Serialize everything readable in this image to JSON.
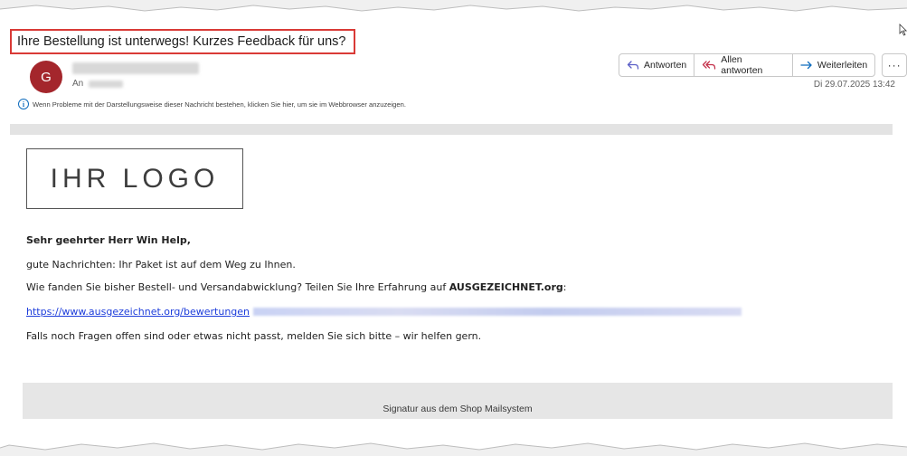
{
  "message": {
    "subject": "Ihre Bestellung ist unterwegs! Kurzes Feedback für uns?",
    "sender_initial": "G",
    "to_label": "An",
    "date": "Di 29.07.2025 13:42",
    "info_text": "Wenn Probleme mit der Darstellungsweise dieser Nachricht bestehen, klicken Sie hier, um sie im Webbrowser anzuzeigen."
  },
  "actions": {
    "reply": "Antworten",
    "reply_all": "Allen antworten",
    "forward": "Weiterleiten",
    "more": "···"
  },
  "body": {
    "logo_text": "IHR LOGO",
    "greeting": "Sehr geehrter Herr Win Help,",
    "line1": "gute Nachrichten: Ihr Paket ist auf dem Weg zu Ihnen.",
    "line2_prefix": "Wie fanden Sie bisher Bestell- und Versandabwicklung? Teilen Sie Ihre Erfahrung auf ",
    "line2_brand": "AUSGEZEICHNET.org",
    "line2_suffix": ":",
    "link_text": "https://www.ausgezeichnet.org/bewertungen",
    "line4": "Falls noch Fragen offen sind oder etwas nicht passt, melden Sie sich bitte – wir helfen gern.",
    "signature": "Signatur aus dem Shop Mailsystem"
  },
  "colors": {
    "subject_highlight": "#d93a36",
    "avatar": "#a4262c",
    "link": "#1d3ddb",
    "accent": "#0f6cbd"
  },
  "icons": [
    "reply-icon",
    "reply-all-icon",
    "forward-icon",
    "more-icon",
    "info-icon",
    "mouse-cursor-icon"
  ]
}
